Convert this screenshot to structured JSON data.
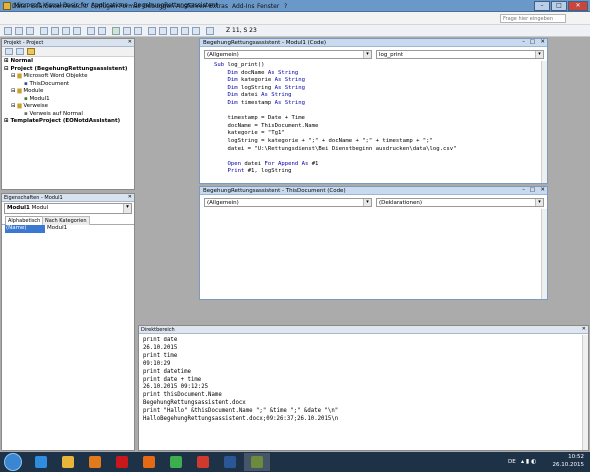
{
  "app_title": "Microsoft Visual Basic for Applications - BegehungRettungsassistent",
  "window_controls": [
    "–",
    "□",
    "✕"
  ],
  "menu": [
    "Datei",
    "Bearbeiten",
    "Ansicht",
    "Einfügen",
    "Format",
    "Debuggen",
    "Ausführen",
    "Extras",
    "Add-Ins",
    "Fenster",
    "?"
  ],
  "help_placeholder": "Frage hier eingeben",
  "toolbar": {
    "position": "Z 11, S 23"
  },
  "project_panel": {
    "title": "Projekt - Project",
    "items": [
      {
        "label": "Normal",
        "bold": true
      },
      {
        "label": "Project (BegehungRettungsassistent)",
        "bold": true
      },
      {
        "label": "Microsoft Word Objekte",
        "bold": false
      },
      {
        "label": "ThisDocument",
        "bold": false
      },
      {
        "label": "Module",
        "bold": false
      },
      {
        "label": "Modul1",
        "bold": false
      },
      {
        "label": "Verweise",
        "bold": false
      },
      {
        "label": "Verweis auf Normal",
        "bold": false
      },
      {
        "label": "TemplateProject (EONotdAssistant)",
        "bold": true
      }
    ]
  },
  "properties_panel": {
    "title": "Eigenschaften - Modul1",
    "object": "Modul1",
    "object_type": "Modul",
    "tabs": [
      "Alphabetisch",
      "Nach Kategorien"
    ],
    "prop_name": "(Name)",
    "prop_value": "Modul1"
  },
  "code_window_1": {
    "title": "BegehungRettungsassistent - Modul1 (Code)",
    "object_combo": "(Allgemein)",
    "proc_combo": "log_print",
    "lines": [
      [
        {
          "t": "Sub ",
          "k": true
        },
        {
          "t": "log_print()"
        }
      ],
      [
        {
          "t": "    Dim ",
          "k": true
        },
        {
          "t": "docName "
        },
        {
          "t": "As String",
          "k": true
        }
      ],
      [
        {
          "t": "    Dim ",
          "k": true
        },
        {
          "t": "kategorie "
        },
        {
          "t": "As String",
          "k": true
        }
      ],
      [
        {
          "t": "    Dim ",
          "k": true
        },
        {
          "t": "logString "
        },
        {
          "t": "As String",
          "k": true
        }
      ],
      [
        {
          "t": "    Dim ",
          "k": true
        },
        {
          "t": "datei "
        },
        {
          "t": "As String",
          "k": true
        }
      ],
      [
        {
          "t": "    Dim ",
          "k": true
        },
        {
          "t": "timestamp "
        },
        {
          "t": "As String",
          "k": true
        }
      ],
      [
        {
          "t": ""
        }
      ],
      [
        {
          "t": "    timestamp = Date + Time"
        }
      ],
      [
        {
          "t": "    docName = ThisDocument.Name"
        }
      ],
      [
        {
          "t": "    kategorie = \"Tg1\""
        }
      ],
      [
        {
          "t": "    logString = kategorie + \";\" + docName + \";\" + timestamp + \";\""
        }
      ],
      [
        {
          "t": "    datei = \"U:\\Rettungsdienst\\Bei Dienstbeginn ausdrucken\\data\\log.csv\""
        }
      ],
      [
        {
          "t": ""
        }
      ],
      [
        {
          "t": "    Open ",
          "k": true
        },
        {
          "t": "datei "
        },
        {
          "t": "For Append As ",
          "k": true
        },
        {
          "t": "#1"
        }
      ],
      [
        {
          "t": "    Print ",
          "k": true
        },
        {
          "t": "#1, logString"
        }
      ]
    ]
  },
  "code_window_2": {
    "title": "BegehungRettungsassistent - ThisDocument (Code)",
    "object_combo": "(Allgemein)",
    "proc_combo": "(Deklarationen)"
  },
  "immediate": {
    "title": "Direktbereich",
    "lines": [
      "print date",
      "26.10.2015",
      "print time",
      "09:10:29",
      "print datetime",
      "print date + time",
      "26.10.2015 09:12:25",
      "print thisDocument.Name",
      "BegehungRettungsassistent.docx",
      "print \"Hallo\" &thisDocument.Name \";\" &time \";\" &date \"\\n\"",
      "HalloBegehungRettungsassistent.docx;09:26:37;26.10.2015\\n"
    ]
  },
  "taskbar": {
    "apps": [
      {
        "icon": "internet-explorer-icon",
        "color": "#2f8de0"
      },
      {
        "icon": "file-explorer-icon",
        "color": "#e9b43a"
      },
      {
        "icon": "media-player-icon",
        "color": "#e07a1c"
      },
      {
        "icon": "acrobat-icon",
        "color": "#c8181c"
      },
      {
        "icon": "firefox-icon",
        "color": "#e66a16"
      },
      {
        "icon": "chrome-icon",
        "color": "#3cae4e"
      },
      {
        "icon": "app-icon",
        "color": "#cf3a2d"
      },
      {
        "icon": "word-icon",
        "color": "#2b5797"
      },
      {
        "icon": "vba-icon",
        "color": "#6d8b3e"
      }
    ],
    "lang": "DE",
    "time": "10:52",
    "date": "26.10.2015"
  }
}
